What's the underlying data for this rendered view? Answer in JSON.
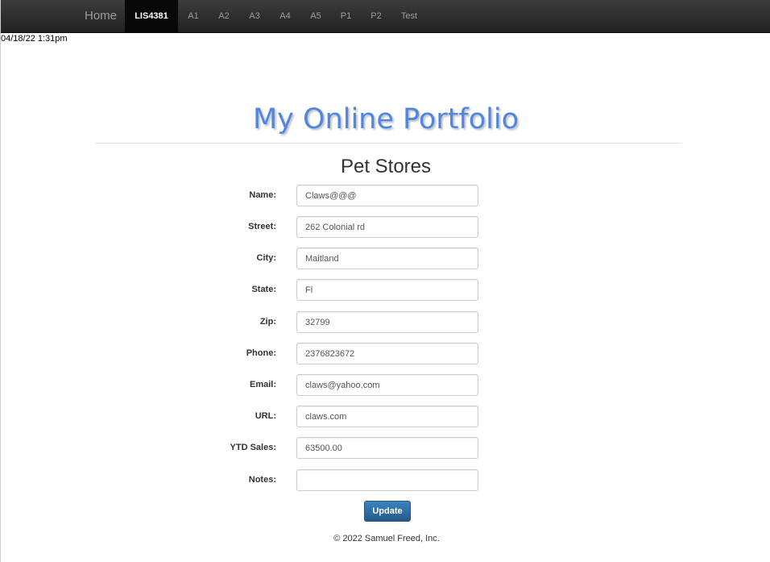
{
  "navbar": {
    "brand": "Home",
    "items": [
      {
        "label": "LIS4381",
        "active": true
      },
      {
        "label": "A1"
      },
      {
        "label": "A2"
      },
      {
        "label": "A3"
      },
      {
        "label": "A4"
      },
      {
        "label": "A5"
      },
      {
        "label": "P1"
      },
      {
        "label": "P2"
      },
      {
        "label": "Test"
      }
    ]
  },
  "timestamp": "04/18/22 1:31pm",
  "page_title": "My Online Portfolio",
  "section_title": "Pet Stores",
  "form": {
    "name": {
      "label": "Name:",
      "value": "Claws@@@"
    },
    "street": {
      "label": "Street:",
      "value": "262 Colonial rd"
    },
    "city": {
      "label": "City:",
      "value": "Maitland"
    },
    "state": {
      "label": "State:",
      "value": "Fl"
    },
    "zip": {
      "label": "Zip:",
      "value": "32799"
    },
    "phone": {
      "label": "Phone:",
      "value": "2376823672"
    },
    "email": {
      "label": "Email:",
      "value": "claws@yahoo.com"
    },
    "url": {
      "label": "URL:",
      "value": "claws.com"
    },
    "ytd_sales": {
      "label": "YTD Sales:",
      "value": "63500.00"
    },
    "notes": {
      "label": "Notes:",
      "value": ""
    },
    "submit_label": "Update"
  },
  "footer": "© 2022 Samuel Freed, Inc.",
  "colors": {
    "navbar_bg": "#222222",
    "title": "#4f86e0",
    "button": "#265a88"
  }
}
